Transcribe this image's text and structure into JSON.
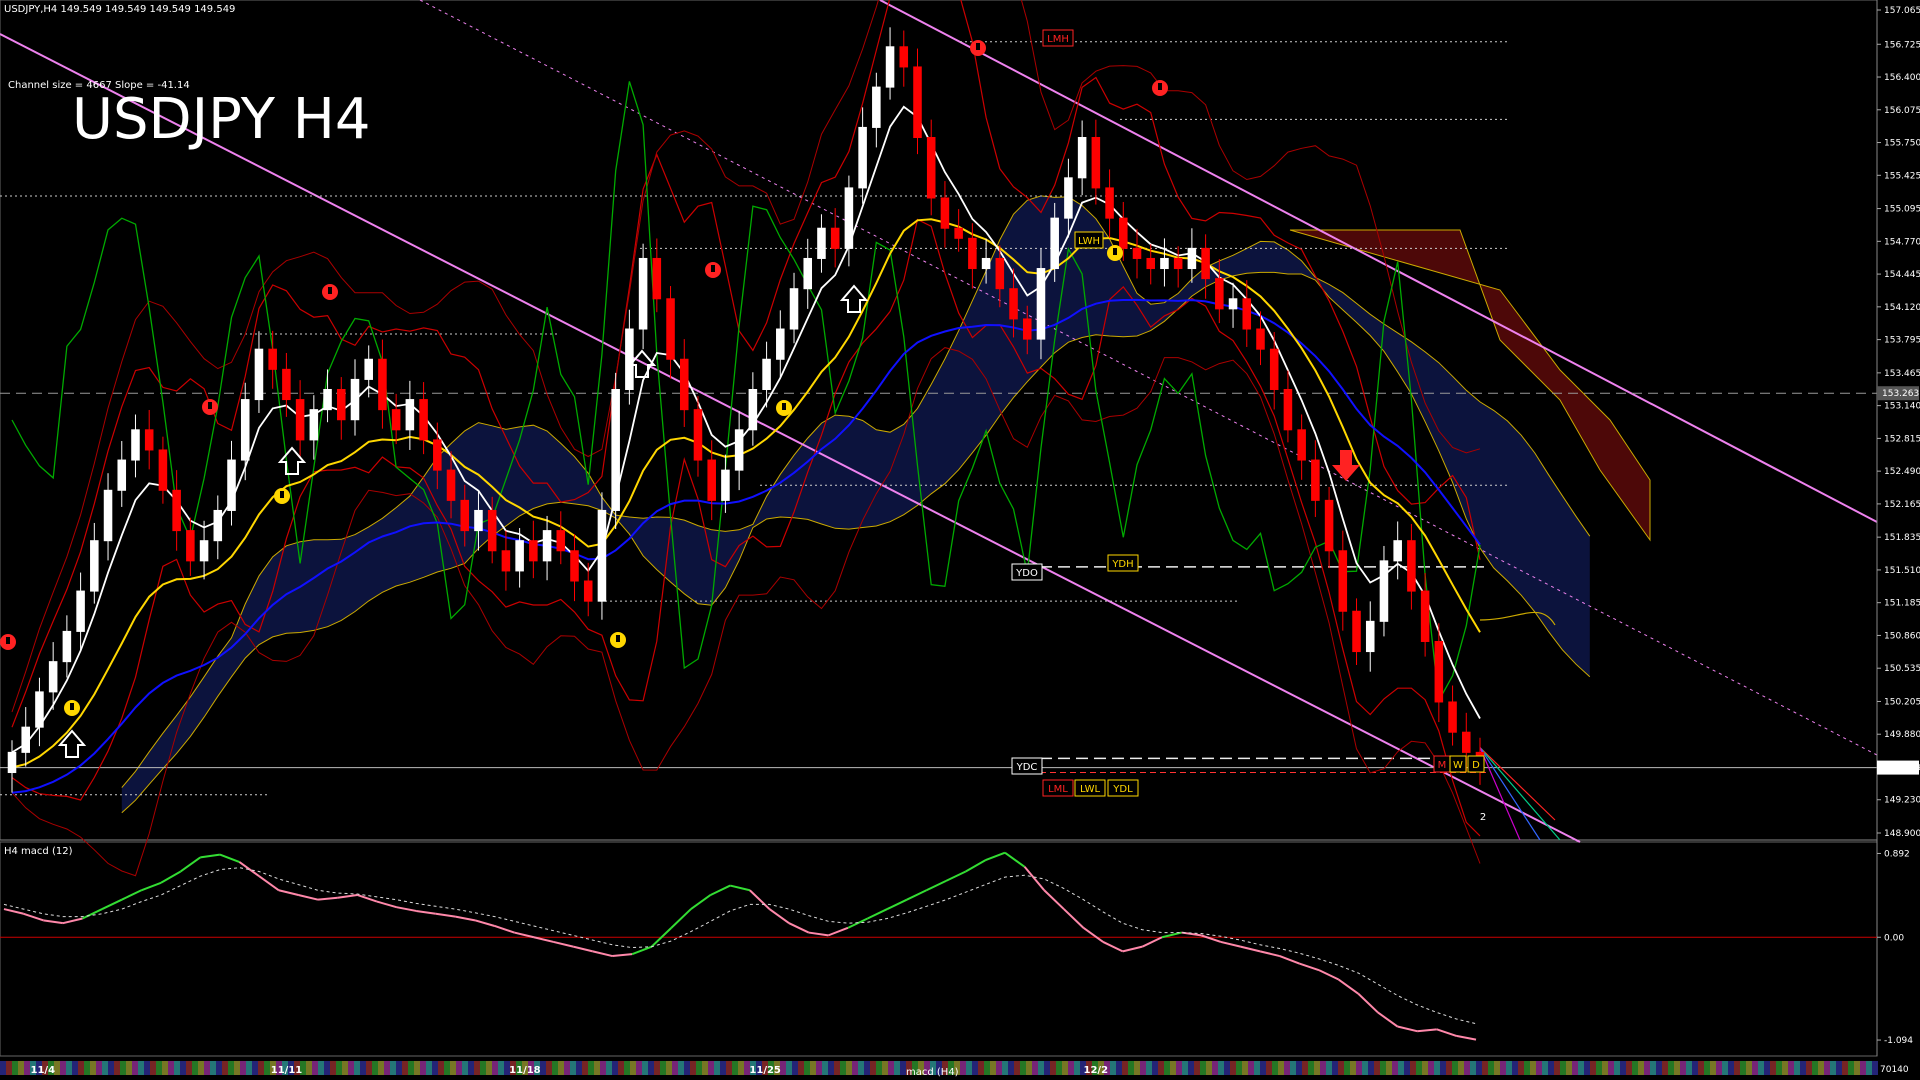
{
  "header": {
    "symbol_line": "USDJPY,H4  149.549 149.549 149.549 149.549",
    "channel_info": "Channel size = 4667 Slope = -41.14",
    "big_title": "USDJPY H4",
    "macd_label": "H4  macd (12)",
    "bottom_tab": "macd (H4)"
  },
  "colors": {
    "background": "#000000",
    "bull_candle": "#ffffff",
    "bear_candle": "#ff0000",
    "channel": "#ee82ee",
    "ma_white": "#ffffff",
    "ma_yellow": "#ffd700",
    "ma_blue": "#1010ff",
    "green_osc": "#00aa00",
    "bands": "#cc0000",
    "macd_up": "#33dd33",
    "macd_down": "#ff88aa",
    "macd_signal": "#dddddd"
  },
  "chart_data": {
    "type": "candlestick",
    "symbol": "USDJPY",
    "timeframe": "H4",
    "ylim": [
      148.9,
      157.065
    ],
    "price_ticks": [
      "157.065",
      "156.725",
      "156.400",
      "156.075",
      "155.750",
      "155.425",
      "155.095",
      "154.770",
      "154.445",
      "154.120",
      "153.795",
      "153.465",
      "153.140",
      "152.815",
      "152.490",
      "152.165",
      "151.835",
      "151.510",
      "151.185",
      "150.860",
      "150.535",
      "150.205",
      "149.880",
      "149.549",
      "149.230",
      "148.900"
    ],
    "price_markers": [
      {
        "label": "153.263",
        "value": 153.263
      },
      {
        "label": "149.549",
        "value": 149.549
      }
    ],
    "macd_ticks": [
      {
        "label": "0.892",
        "value": 0.892
      },
      {
        "label": "0.00",
        "value": 0.0
      },
      {
        "label": "-1.094",
        "value": -1.094
      }
    ],
    "macd_ylim": [
      -1.2,
      0.95
    ],
    "bottom_value": "70140",
    "date_labels": [
      {
        "label": "11/4",
        "t": 0.012
      },
      {
        "label": "11/11",
        "t": 0.14
      },
      {
        "label": "11/18",
        "t": 0.267
      },
      {
        "label": "11/25",
        "t": 0.395
      },
      {
        "label": "12/2",
        "t": 0.573
      }
    ],
    "level_tags": [
      {
        "label": "LMH",
        "color": "#ff2222"
      },
      {
        "label": "LWH",
        "color": "#ffd700"
      },
      {
        "label": "YDO",
        "color": "#ffffff"
      },
      {
        "label": "YDH",
        "color": "#ffd700"
      },
      {
        "label": "YDC",
        "color": "#ffffff"
      },
      {
        "label": "LML",
        "color": "#ff2222"
      },
      {
        "label": "LWL",
        "color": "#ffd700"
      },
      {
        "label": "YDL",
        "color": "#ffd700"
      },
      {
        "label": "M",
        "color": "#ff2222"
      },
      {
        "label": "W",
        "color": "#ffd700"
      },
      {
        "label": "D",
        "color": "#ffd700"
      },
      {
        "label": "2",
        "color": "#ffffff"
      }
    ],
    "close_series": [
      149.7,
      149.95,
      150.3,
      150.6,
      150.9,
      151.3,
      151.8,
      152.3,
      152.6,
      152.9,
      152.7,
      152.3,
      151.9,
      151.6,
      151.8,
      152.1,
      152.6,
      153.2,
      153.7,
      153.5,
      153.2,
      152.8,
      153.1,
      153.3,
      153.0,
      153.4,
      153.6,
      153.1,
      152.9,
      153.2,
      152.8,
      152.5,
      152.2,
      151.9,
      152.1,
      151.7,
      151.5,
      151.8,
      151.6,
      151.9,
      151.7,
      151.4,
      151.2,
      152.1,
      153.3,
      153.9,
      154.6,
      154.2,
      153.6,
      153.1,
      152.6,
      152.2,
      152.5,
      152.9,
      153.3,
      153.6,
      153.9,
      154.3,
      154.6,
      154.9,
      154.7,
      155.3,
      155.9,
      156.3,
      156.7,
      156.5,
      155.8,
      155.2,
      154.9,
      154.8,
      154.5,
      154.6,
      154.3,
      154.0,
      153.8,
      154.5,
      155.0,
      155.4,
      155.8,
      155.3,
      155.0,
      154.7,
      154.6,
      154.5,
      154.6,
      154.5,
      154.7,
      154.4,
      154.1,
      154.2,
      153.9,
      153.7,
      153.3,
      152.9,
      152.6,
      152.2,
      151.7,
      151.1,
      150.7,
      151.0,
      151.6,
      151.8,
      151.3,
      150.8,
      150.2,
      149.9,
      149.7,
      149.549
    ],
    "macd_series": [
      0.3,
      0.25,
      0.18,
      0.15,
      0.2,
      0.3,
      0.4,
      0.5,
      0.58,
      0.7,
      0.85,
      0.88,
      0.8,
      0.65,
      0.5,
      0.45,
      0.4,
      0.42,
      0.45,
      0.38,
      0.32,
      0.28,
      0.25,
      0.22,
      0.18,
      0.12,
      0.05,
      0.0,
      -0.05,
      -0.1,
      -0.15,
      -0.2,
      -0.18,
      -0.1,
      0.1,
      0.3,
      0.45,
      0.55,
      0.5,
      0.3,
      0.15,
      0.05,
      0.02,
      0.1,
      0.2,
      0.3,
      0.4,
      0.5,
      0.6,
      0.7,
      0.82,
      0.9,
      0.75,
      0.5,
      0.3,
      0.1,
      -0.05,
      -0.15,
      -0.1,
      0.0,
      0.05,
      0.02,
      -0.05,
      -0.1,
      -0.15,
      -0.2,
      -0.28,
      -0.35,
      -0.45,
      -0.6,
      -0.8,
      -0.95,
      -1.0,
      -0.98,
      -1.05,
      -1.09
    ],
    "signal_series": [
      0.35,
      0.3,
      0.25,
      0.22,
      0.22,
      0.25,
      0.3,
      0.38,
      0.45,
      0.55,
      0.65,
      0.72,
      0.74,
      0.7,
      0.62,
      0.56,
      0.5,
      0.47,
      0.46,
      0.43,
      0.4,
      0.36,
      0.33,
      0.3,
      0.26,
      0.22,
      0.17,
      0.12,
      0.07,
      0.02,
      -0.03,
      -0.08,
      -0.11,
      -0.1,
      -0.04,
      0.06,
      0.17,
      0.28,
      0.35,
      0.35,
      0.3,
      0.23,
      0.17,
      0.15,
      0.16,
      0.2,
      0.26,
      0.33,
      0.4,
      0.48,
      0.56,
      0.64,
      0.66,
      0.62,
      0.52,
      0.4,
      0.27,
      0.15,
      0.08,
      0.05,
      0.05,
      0.04,
      0.01,
      -0.03,
      -0.08,
      -0.12,
      -0.17,
      -0.23,
      -0.3,
      -0.38,
      -0.5,
      -0.62,
      -0.72,
      -0.8,
      -0.87,
      -0.92
    ]
  }
}
